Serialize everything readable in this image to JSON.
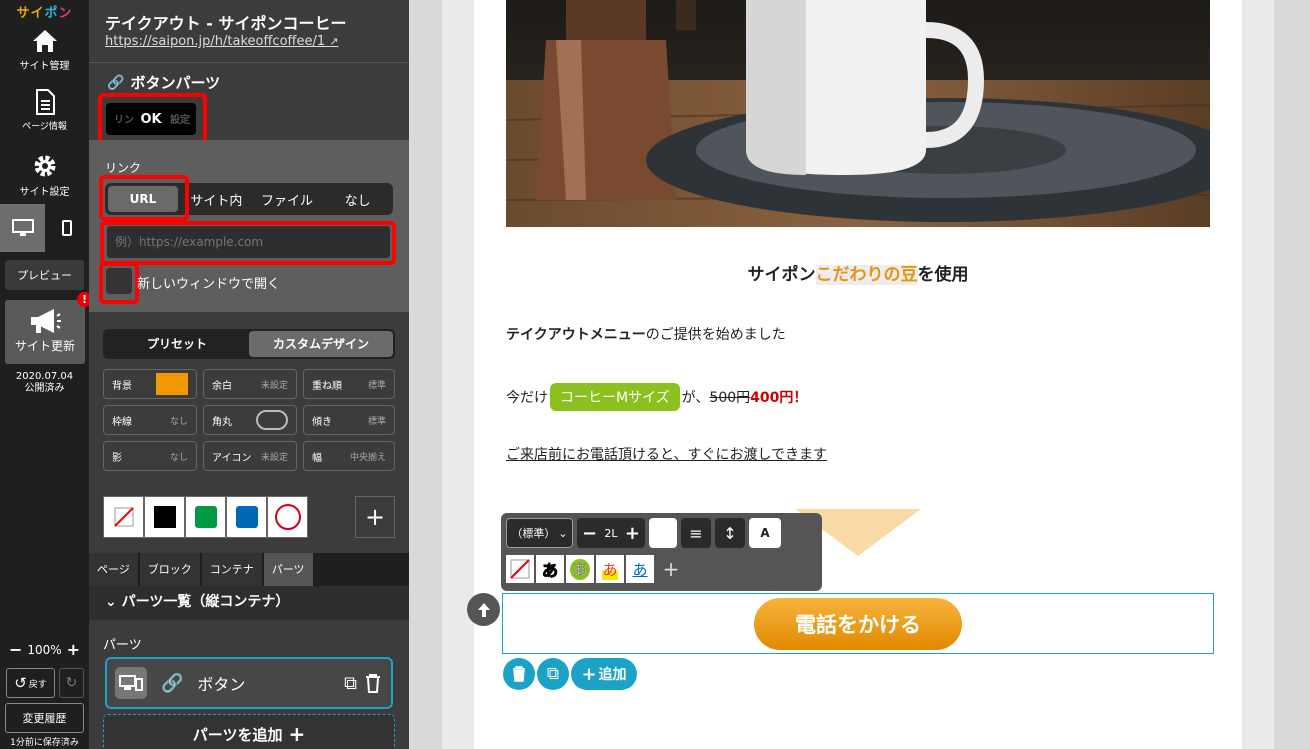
{
  "rail": {
    "logo": "サイポン",
    "site_manage": "サイト管理",
    "page_info": "ページ情報",
    "site_settings": "サイト設定",
    "preview": "プレビュー",
    "update": "サイト更新",
    "badge": "!",
    "pub_date": "2020.07.04",
    "pub_status": "公開済み",
    "zoom": "100%",
    "undo": "戻す",
    "history": "変更履歴",
    "saved": "1分前に保存済み"
  },
  "panel": {
    "title": "テイクアウト - サイポンコーヒー",
    "url": "https://saipon.jp/h/takeoffcoffee/1",
    "section": "ボタンパーツ",
    "preview_label": "OK",
    "preview_ghost_left": "リン",
    "preview_ghost_right": "設定",
    "link_label": "リンク",
    "link_tabs": [
      "URL",
      "サイト内",
      "ファイル",
      "なし"
    ],
    "url_placeholder": "例）https://example.com",
    "new_window": "新しいウィンドウで開く",
    "design_tabs": [
      "プリセット",
      "カスタムデザイン"
    ],
    "props": [
      {
        "label": "背景",
        "value": ""
      },
      {
        "label": "余白",
        "value": "未設定"
      },
      {
        "label": "重ね順",
        "value": "標準"
      },
      {
        "label": "枠線",
        "value": "なし"
      },
      {
        "label": "角丸",
        "value": ""
      },
      {
        "label": "傾き",
        "value": "標準"
      },
      {
        "label": "影",
        "value": "なし"
      },
      {
        "label": "アイコン",
        "value": "未設定"
      },
      {
        "label": "幅",
        "value": "中央揃え"
      }
    ],
    "bottom_tabs": [
      "ページ",
      "ブロック",
      "コンテナ",
      "パーツ"
    ],
    "list_head": "パーツ一覧（縦コンテナ）",
    "parts_label": "パーツ",
    "part_name": "ボタン",
    "add_part": "パーツを追加"
  },
  "colors": {
    "bg_swatch": "#f39800",
    "accent": "#1aa3c7",
    "highlight": "#e8940f",
    "price_red": "#cc0000",
    "pill_green": "#8bc11f"
  },
  "content": {
    "h1_pre": "サイポン",
    "h1_hl": "こだわりの豆",
    "h1_post": "を使用",
    "p1_bold": "テイクアウトメニュー",
    "p1_rest": "のご提供を始めました",
    "p2_pre": "今だけ",
    "p2_pill": "コーヒーMサイズ",
    "p2_mid": "が、",
    "p2_old": "500円",
    "p2_new": "400円！",
    "p3": "ご来店前にお電話頂けると、すぐにお渡しできます",
    "tel_button": "電話をかける",
    "add": "追加"
  },
  "toolbar": {
    "font_select": "（標準）",
    "size": "2L",
    "a_label": "A",
    "chars": [
      "あ",
      "あ",
      "あ",
      "あ"
    ]
  }
}
